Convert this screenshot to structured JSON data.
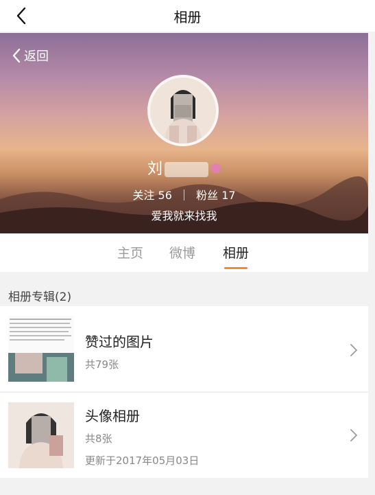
{
  "header": {
    "title": "相册"
  },
  "hero": {
    "back_label": "返回",
    "user_name": "刘",
    "following_label": "关注",
    "following_count": "56",
    "followers_label": "粉丝",
    "followers_count": "17",
    "bio": "爱我就来找我"
  },
  "tabs": [
    {
      "label": "主页"
    },
    {
      "label": "微博"
    },
    {
      "label": "相册"
    }
  ],
  "albums_section": {
    "title": "相册专辑(2)",
    "items": [
      {
        "name": "赞过的图片",
        "count": "共79张"
      },
      {
        "name": "头像相册",
        "count": "共8张",
        "updated": "更新于2017年05月03日"
      }
    ]
  },
  "colors": {
    "accent": "#f08a2d",
    "tab_inactive": "#9a9a9a"
  }
}
